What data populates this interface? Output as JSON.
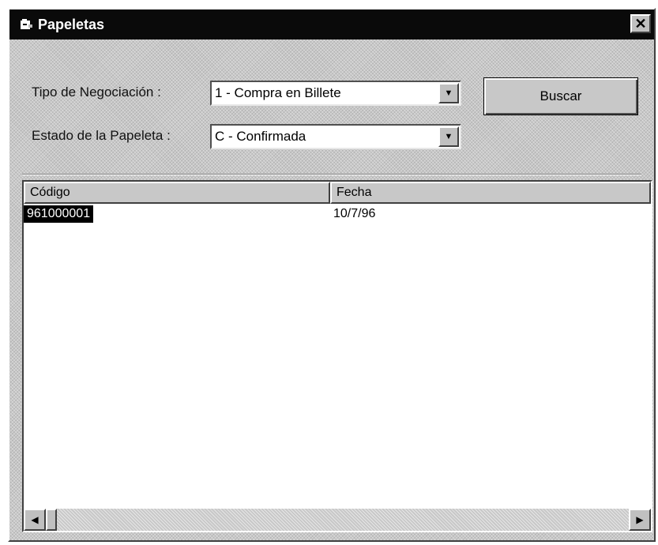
{
  "window": {
    "title": "Papeletas",
    "close_glyph": "✕"
  },
  "filters": {
    "tipo_label": "Tipo de Negociación :",
    "tipo_value": "1 - Compra en Billete",
    "estado_label": "Estado de la Papeleta :",
    "estado_value": "C - Confirmada",
    "arrow_glyph": "▼"
  },
  "buttons": {
    "buscar_label": "Buscar"
  },
  "table": {
    "columns": [
      "Código",
      "Fecha"
    ],
    "rows": [
      {
        "codigo": "961000001",
        "fecha": "10/7/96",
        "selected": true
      }
    ]
  },
  "scrollbar": {
    "left_glyph": "◀",
    "right_glyph": "▶"
  },
  "icons": {
    "app": "papeletas-app-icon",
    "close": "close-icon",
    "dropdown": "chevron-down-icon",
    "scroll_left": "scroll-left-icon",
    "scroll_right": "scroll-right-icon"
  },
  "colors": {
    "title_bar": "#0a0a0a",
    "selection": "#000000",
    "face": "#c8c8c8"
  }
}
